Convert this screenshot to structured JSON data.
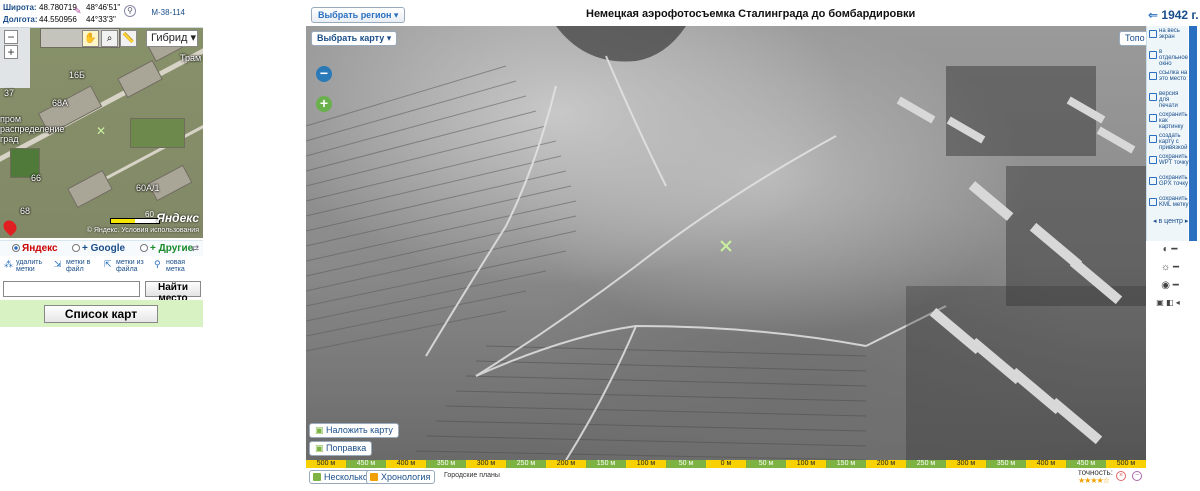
{
  "left_panel": {
    "lat_label": "Широта:",
    "lat_decimal": "48.780719",
    "lat_dms": "48°46'51\"",
    "lon_label": "Долгота:",
    "lon_decimal": "44.550956",
    "lon_dms": "44°33'3\"",
    "sheet": "М-38-114",
    "map_type": "Гибрид",
    "minimap_labels": [
      "Трам",
      "16Б",
      "68А",
      "66",
      "68",
      "60А/1",
      "37",
      "пром\nраспределение\nград"
    ],
    "scale_label": "60",
    "logo": "Яндекс",
    "terms": "© Яндекс. Условия использования",
    "providers": [
      "Яндекс",
      "Google",
      "Другие"
    ],
    "marks": [
      "удалить метки",
      "метки в файл",
      "метки из файла",
      "новая метка"
    ],
    "search_placeholder": "",
    "search_button": "Найти место",
    "list_button": "Список карт"
  },
  "main": {
    "region_button": "Выбрать регион",
    "title": "Немецкая аэрофотосъемка Сталинграда до бомбардировки",
    "year": "1942 г.",
    "map_button": "Выбрать карту",
    "topo_button": "Топо",
    "overlay_button": "Наложить карту",
    "correction_button": "Поправка",
    "scale_ticks": [
      "500 м",
      "450 м",
      "400 м",
      "350 м",
      "300 м",
      "250 м",
      "200 м",
      "150 м",
      "100 м",
      "50 м",
      "0 м",
      "50 м",
      "100 м",
      "150 м",
      "200 м",
      "250 м",
      "300 м",
      "350 м",
      "400 м",
      "450 м",
      "500 м"
    ],
    "several_button": "Несколько",
    "chronology_button": "Хронология",
    "city_plans": "Городские планы",
    "accuracy_label": "точность:"
  },
  "tools": [
    "на весь экран",
    "в отдельное окно",
    "ссылка на это место",
    "версия для печати",
    "сохранить как картинку",
    "создать карту с привязкой",
    "сохранить WPT точку",
    "сохранить GPX точку",
    "сохранить KML метку",
    "в центр"
  ]
}
